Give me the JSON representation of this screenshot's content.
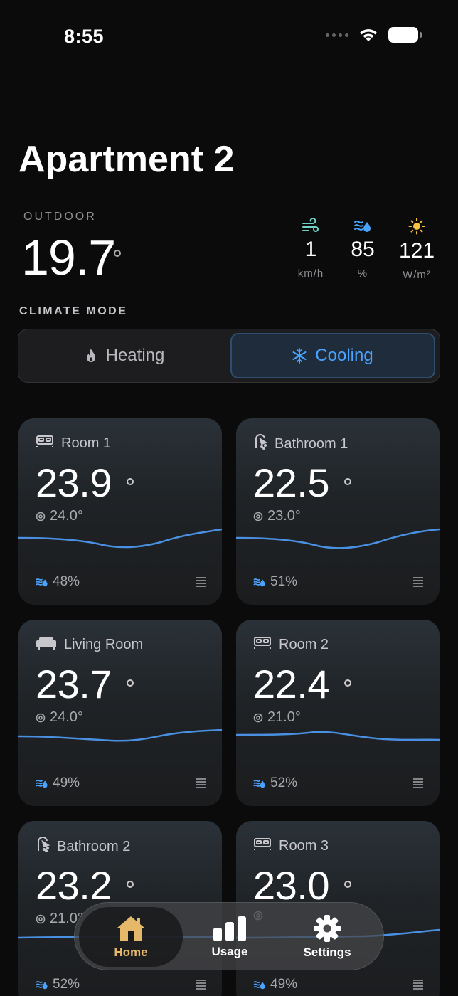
{
  "status": {
    "time": "8:55"
  },
  "page": {
    "title": "Apartment 2"
  },
  "outdoor": {
    "label": "OUTDOOR",
    "temperature": "19.7",
    "metrics": [
      {
        "icon": "wind-icon",
        "value": "1",
        "unit": "km/h",
        "color": "#6fd3c8"
      },
      {
        "icon": "humidity-icon",
        "value": "85",
        "unit": "%",
        "color": "#4aa3ff"
      },
      {
        "icon": "sun-icon",
        "value": "121",
        "unit": "W/m²",
        "color": "#f5c242"
      }
    ]
  },
  "climate": {
    "label": "CLIMATE MODE",
    "heating": "Heating",
    "cooling": "Cooling",
    "selected": "Cooling",
    "accent": "#4aa3ff"
  },
  "rooms": [
    {
      "name": "Room 1",
      "icon": "bed-icon",
      "temperature": "23.9",
      "target": "24.0°",
      "humidity": "48%"
    },
    {
      "name": "Bathroom 1",
      "icon": "shower-icon",
      "temperature": "22.5",
      "target": "23.0°",
      "humidity": "51%"
    },
    {
      "name": "Living Room",
      "icon": "sofa-icon",
      "temperature": "23.7",
      "target": "24.0°",
      "humidity": "49%"
    },
    {
      "name": "Room 2",
      "icon": "bed-icon",
      "temperature": "22.4",
      "target": "21.0°",
      "humidity": "52%"
    },
    {
      "name": "Bathroom 2",
      "icon": "shower-icon",
      "temperature": "23.2",
      "target": "21.0°",
      "humidity": "52%"
    },
    {
      "name": "Room 3",
      "icon": "bed-icon",
      "temperature": "23.0",
      "target": "",
      "humidity": "49%"
    }
  ],
  "tabs": {
    "home": "Home",
    "usage": "Usage",
    "settings": "Settings",
    "active_color": "#e6b86a"
  }
}
